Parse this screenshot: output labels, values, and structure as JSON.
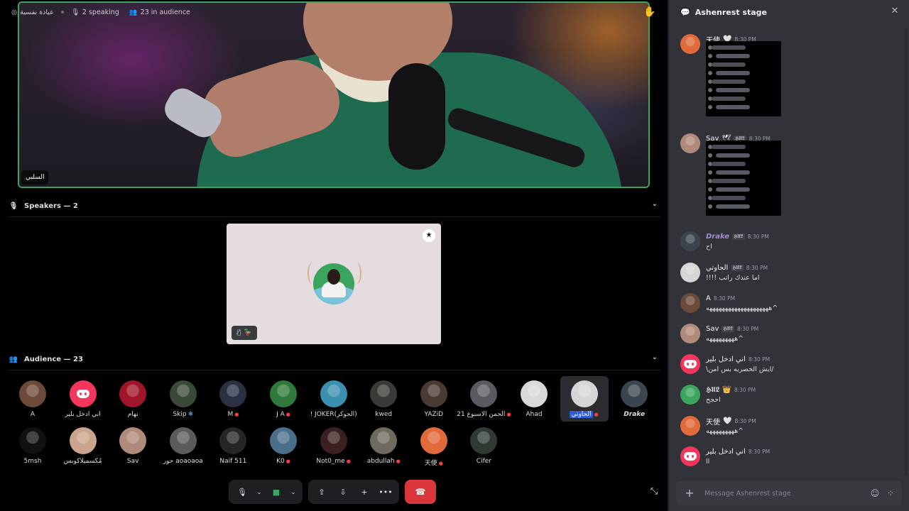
{
  "top_bar": {
    "stage_name": "عيادة نفسية",
    "speaking": "2 speaking",
    "audience": "23 in audience"
  },
  "video": {
    "name": "السلبي"
  },
  "speakers": {
    "heading": "Speakers — 2"
  },
  "audience": {
    "heading": "Audience — 23",
    "members": [
      {
        "name": "A",
        "muted": false,
        "color": "#6b4a3a"
      },
      {
        "name": "اني ادخل بلير",
        "muted": false,
        "color": "#f2365c",
        "discord": true
      },
      {
        "name": "نهام",
        "muted": false,
        "color": "#a0152a"
      },
      {
        "name": "Skip",
        "muted": false,
        "color": "#3a4a38",
        "snow": "❄"
      },
      {
        "name": "M",
        "muted": true,
        "color": "#2a3142"
      },
      {
        "name": "J A",
        "muted": true,
        "color": "#2f7a3a"
      },
      {
        "name": "! JOKER(الجوكر)",
        "muted": false,
        "color": "#3b8fb0"
      },
      {
        "name": "kwed",
        "muted": false,
        "color": "#3a3a36"
      },
      {
        "name": "YAZiD",
        "muted": false,
        "color": "#4a3a34"
      },
      {
        "name": "الحمن الاسبوع 21",
        "muted": true,
        "color": "#5a5b60"
      },
      {
        "name": "Ahad",
        "muted": false,
        "color": "#d9d9d9"
      },
      {
        "name": "الحاوتي",
        "muted": true,
        "color": "#d6d6d6",
        "selected": true
      },
      {
        "name": "Drake",
        "muted": false,
        "color": "#3a4550",
        "bold": true
      },
      {
        "name": "5msh",
        "muted": false,
        "color": "#111111"
      },
      {
        "name": "مُكسميلاكوبس",
        "muted": false,
        "color": "#caa48c"
      },
      {
        "name": "Sav",
        "muted": false,
        "color": "#b08a7a"
      },
      {
        "name": "حور aoaoaoa",
        "muted": false,
        "color": "#5c5a5a"
      },
      {
        "name": "Naif 511",
        "muted": false,
        "color": "#252525"
      },
      {
        "name": "K0",
        "muted": true,
        "color": "#4a6f8a"
      },
      {
        "name": "Not0_me",
        "muted": true,
        "color": "#3a2020"
      },
      {
        "name": "abdullah",
        "muted": true,
        "color": "#6e6a5e"
      },
      {
        "name": "天使",
        "muted": true,
        "color": "#e06a3a"
      },
      {
        "name": "Cifer",
        "muted": false,
        "color": "#2f3a33"
      }
    ]
  },
  "controls": {
    "mic": "🎙",
    "video": "■",
    "share": "⇪",
    "move": "⇩",
    "invite": "+",
    "more": "•••",
    "leave": "☎"
  },
  "chat": {
    "title": "Ashenrest stage",
    "placeholder": "Message Ashenrest stage",
    "messages": [
      {
        "user": "天使",
        "badge": "🤍",
        "time": "8:30 PM",
        "image": true,
        "color": "#e06a3a"
      },
      {
        "user": "Sav",
        "badge": "🕊",
        "tag": "𝕳𝖀𝕷",
        "time": "8:30 PM",
        "image": true,
        "color": "#b08a7a"
      },
      {
        "user": "Drake",
        "tag": "𝕳𝖀𝕷",
        "time": "8:30 PM",
        "text": "اح",
        "color": "#3a4550",
        "italic": true
      },
      {
        "user": "الحاوتي",
        "tag": "𝕳𝖀𝕷",
        "time": "8:30 PM",
        "text": "!!!! اما عندك راتب",
        "color": "#d6d6d6"
      },
      {
        "user": "A",
        "time": "8:30 PM",
        "text": "ههههههههههههههههههههه^",
        "color": "#6b4a3a"
      },
      {
        "user": "Sav",
        "tag": "𝕳𝖀𝕷",
        "time": "8:30 PM",
        "text": "هههههههههه^",
        "color": "#b08a7a"
      },
      {
        "user": "اني ادخل بلير",
        "time": "8:30 PM",
        "text": "\\ايش الخصريه بس امن/",
        "color": "#f2365c",
        "discord": true
      },
      {
        "user": "𝕳𝖀𝕷",
        "crown": "👑",
        "time": "8:30 PM",
        "text": "احجح",
        "color": "#3ba55d"
      },
      {
        "user": "天使",
        "badge": "🤍",
        "time": "8:30 PM",
        "text": "هههههههههه^",
        "color": "#e06a3a"
      },
      {
        "user": "اني ادخل بلير",
        "time": "8:30 PM",
        "text": "اا",
        "color": "#f2365c",
        "discord": true
      }
    ]
  },
  "colors": {
    "speaking_border": "#3ba55d",
    "leave_red": "#da373c",
    "selected_highlight": "#2f5bd6"
  }
}
